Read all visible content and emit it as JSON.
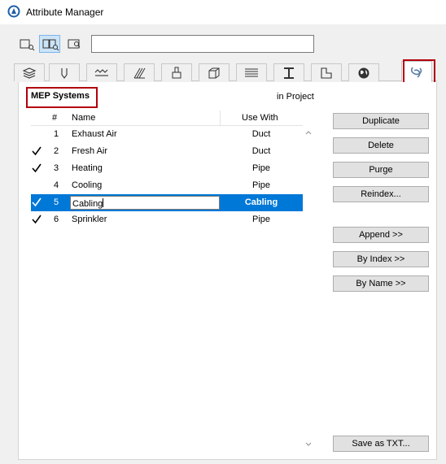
{
  "window": {
    "title": "Attribute Manager"
  },
  "toolbar": {
    "search_value": "",
    "search_placeholder": ""
  },
  "section": {
    "title": "MEP Systems",
    "scope_label": "in Project"
  },
  "list": {
    "headers": {
      "number": "#",
      "name": "Name",
      "use_with": "Use With"
    },
    "rows": [
      {
        "checked": false,
        "number": "1",
        "name": "Exhaust Air",
        "use_with": "Duct"
      },
      {
        "checked": true,
        "number": "2",
        "name": "Fresh Air",
        "use_with": "Duct"
      },
      {
        "checked": true,
        "number": "3",
        "name": "Heating",
        "use_with": "Pipe"
      },
      {
        "checked": false,
        "number": "4",
        "name": "Cooling",
        "use_with": "Pipe"
      },
      {
        "checked": true,
        "number": "5",
        "name": "Cabling",
        "use_with": "Cabling",
        "selected": true,
        "editing": true
      },
      {
        "checked": true,
        "number": "6",
        "name": "Sprinkler",
        "use_with": "Pipe"
      }
    ]
  },
  "buttons": {
    "duplicate": "Duplicate",
    "delete": "Delete",
    "purge": "Purge",
    "reindex": "Reindex...",
    "append": "Append >>",
    "by_index": "By Index >>",
    "by_name": "By Name >>",
    "save_txt": "Save as TXT..."
  },
  "colors": {
    "selection": "#0078d7",
    "highlight_frame": "#b3000c",
    "active_view": "#cce4f7"
  }
}
